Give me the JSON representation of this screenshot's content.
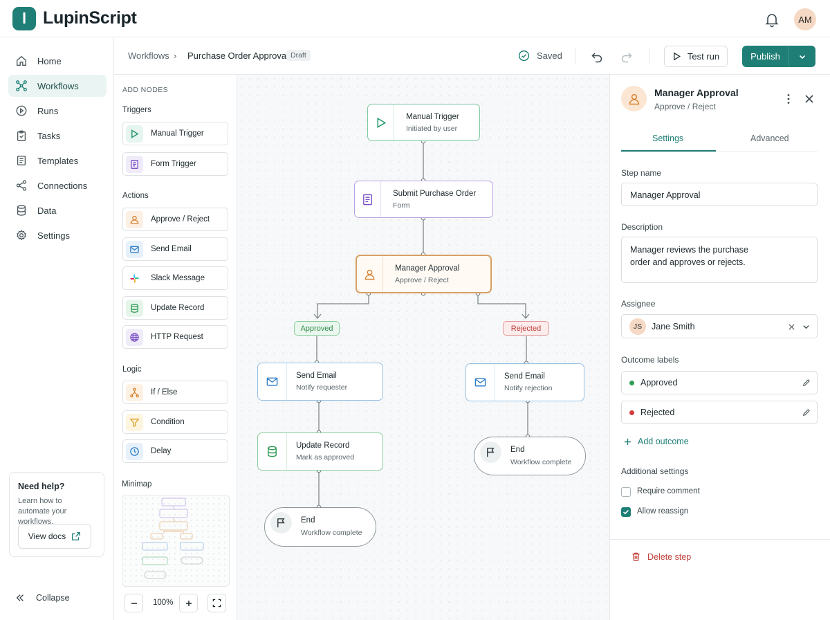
{
  "app": {
    "brand": "LupinScript",
    "logo_letter": "l",
    "user_initials": "AM"
  },
  "sidebar": {
    "items": [
      {
        "label": "Home",
        "icon": "home-icon"
      },
      {
        "label": "Workflows",
        "icon": "workflow-icon",
        "active": true
      },
      {
        "label": "Runs",
        "icon": "play-circle-icon"
      },
      {
        "label": "Tasks",
        "icon": "clipboard-icon"
      },
      {
        "label": "Templates",
        "icon": "template-icon"
      },
      {
        "label": "Connections",
        "icon": "share-icon"
      },
      {
        "label": "Data",
        "icon": "database-icon"
      },
      {
        "label": "Settings",
        "icon": "gear-icon"
      }
    ],
    "help": {
      "title": "Need help?",
      "text": "Learn how to automate your workflows.",
      "button": "View docs"
    },
    "collapse": "Collapse"
  },
  "header": {
    "breadcrumb_root": "Workflows",
    "breadcrumb_current": "Purchase Order Approval",
    "badge": "Draft",
    "saved": "Saved",
    "test_run": "Test run",
    "publish": "Publish"
  },
  "palette": {
    "title": "ADD NODES",
    "groups": [
      {
        "label": "Triggers",
        "items": [
          "Manual Trigger",
          "Form Trigger"
        ]
      },
      {
        "label": "Actions",
        "items": [
          "Approve / Reject",
          "Send Email",
          "Slack Message",
          "Update Record",
          "HTTP Request"
        ]
      },
      {
        "label": "Logic",
        "items": [
          "If / Else",
          "Condition",
          "Delay"
        ]
      }
    ],
    "minimap": "Minimap",
    "zoom": "100%"
  },
  "canvas": {
    "nodes": [
      {
        "id": "manual-trigger",
        "title": "Manual Trigger",
        "subtitle": "Initiated by user"
      },
      {
        "id": "submit-po",
        "title": "Submit Purchase Order",
        "subtitle": "Form"
      },
      {
        "id": "manager-approval",
        "title": "Manager Approval",
        "subtitle": "Approve / Reject"
      },
      {
        "id": "email-approved",
        "title": "Send Email",
        "subtitle": "Notify requester"
      },
      {
        "id": "email-rejected",
        "title": "Send Email",
        "subtitle": "Notify rejection"
      },
      {
        "id": "update-record",
        "title": "Update Record",
        "subtitle": "Mark as approved"
      },
      {
        "id": "end-right",
        "title": "End",
        "subtitle": "Workflow complete"
      },
      {
        "id": "end-left",
        "title": "End",
        "subtitle": "Workflow complete"
      }
    ],
    "branches": {
      "approved": "Approved",
      "rejected": "Rejected"
    }
  },
  "panel": {
    "title": "Manager Approval",
    "subtitle": "Approve / Reject",
    "tabs": [
      "Settings",
      "Advanced"
    ],
    "step_name_label": "Step name",
    "step_name": "Manager Approval",
    "description_label": "Description",
    "description": "Manager reviews the purchase order and approves or rejects.",
    "assignee_label": "Assignee",
    "assignee_initials": "JS",
    "assignee": "Jane Smith",
    "outcomes_label": "Outcome labels",
    "outcomes": [
      {
        "label": "Approved",
        "color": "#2f9e55"
      },
      {
        "label": "Rejected",
        "color": "#d23b3b"
      }
    ],
    "add_outcome": "Add outcome",
    "additional_label": "Additional settings",
    "options": [
      {
        "label": "Require comment",
        "checked": false
      },
      {
        "label": "Allow reassign",
        "checked": true
      }
    ],
    "delete": "Delete step"
  },
  "colors": {
    "accent": "#1f7f76",
    "approved": "#2f9e55",
    "rejected": "#d23b3b",
    "danger": "#c2413b"
  }
}
